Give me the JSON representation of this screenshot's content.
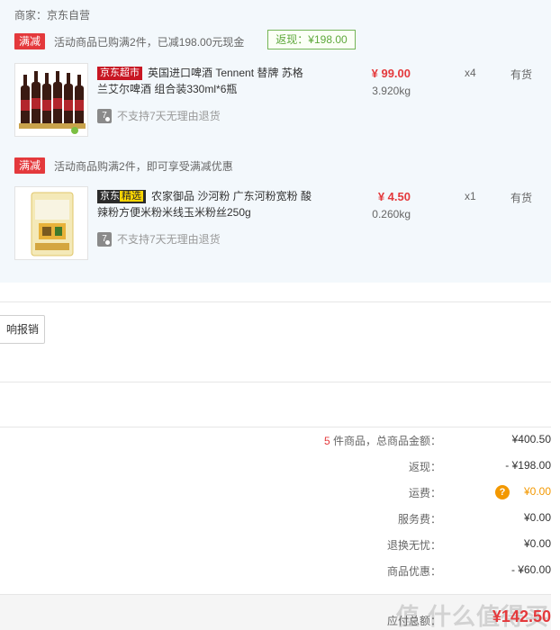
{
  "seller": {
    "label": "商家：京东自营"
  },
  "promos": [
    {
      "tag": "满减",
      "text": "活动商品已购满2件，已减198.00元现金",
      "rebate": "返现：¥198.00"
    },
    {
      "tag": "满减",
      "text": "活动商品购满2件，即可享受满减优惠"
    }
  ],
  "products": [
    {
      "brand_tag": "京东超市",
      "title": "英国进口啤酒 Tennent 替牌 苏格兰艾尔啤酒 组合装330ml*6瓶",
      "return_icon": "7",
      "return_note": "不支持7天无理由退货",
      "price": "¥ 99.00",
      "weight": "3.920kg",
      "qty": "x4",
      "stock": "有货"
    },
    {
      "brand_tag_a": "京东",
      "brand_tag_b": "精选",
      "title": "农家御品 沙河粉 广东河粉宽粉 酸辣粉方便米粉米线玉米粉丝250g",
      "return_icon": "7",
      "return_note": "不支持7天无理由退货",
      "price": "¥ 4.50",
      "weight": "0.260kg",
      "qty": "x1",
      "stock": "有货"
    }
  ],
  "reimburse": {
    "label": "响报销"
  },
  "summary": {
    "count": "5",
    "count_suffix": " 件商品，总商品金额：",
    "total_goods": "¥400.50",
    "rebate_label": "返现：",
    "rebate_value": "- ¥198.00",
    "shipping_label": "运费：",
    "shipping_help": "?",
    "shipping_value": "¥0.00",
    "service_label": "服务费：",
    "service_value": "¥0.00",
    "worry_free_label": "退换无忧：",
    "worry_free_value": "¥0.00",
    "discount_label": "商品优惠：",
    "discount_value": "- ¥60.00"
  },
  "total": {
    "label": "应付总额：",
    "value": "¥142.50"
  },
  "watermark": "值 什么值得买",
  "colors": {
    "accent_red": "#e4393c",
    "rebate_green": "#5ea83c",
    "panel_bg": "#f3f8fc",
    "orange": "#f39800"
  }
}
